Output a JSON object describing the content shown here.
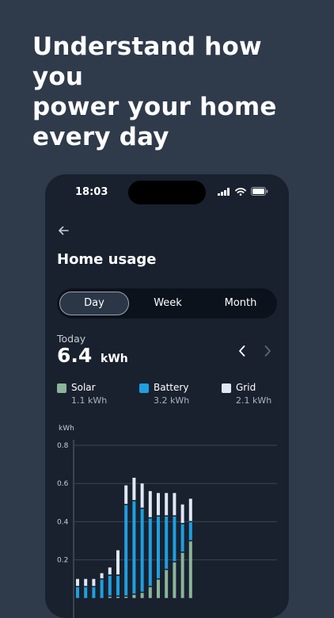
{
  "headline": [
    "Understand how you",
    "power your home",
    "every day"
  ],
  "status_bar": {
    "time": "18:03"
  },
  "screen": {
    "title": "Home usage",
    "tabs": [
      {
        "label": "Day",
        "active": true
      },
      {
        "label": "Week",
        "active": false
      },
      {
        "label": "Month",
        "active": false
      }
    ],
    "summary": {
      "period": "Today",
      "value": "6.4",
      "unit": "kWh"
    },
    "legend": [
      {
        "name": "Solar",
        "value": "1.1 kWh",
        "color": "#8ab59a"
      },
      {
        "name": "Battery",
        "value": "3.2 kWh",
        "color": "#1f9fe0"
      },
      {
        "name": "Grid",
        "value": "2.1 kWh",
        "color": "#dfe8f6"
      }
    ]
  },
  "chart_data": {
    "type": "bar",
    "stacked": true,
    "ylabel": "kWh",
    "ylim": [
      0,
      0.8
    ],
    "yticks": [
      "0.8",
      "0.6",
      "0.4",
      "0.2"
    ],
    "grid": true,
    "colors": {
      "Solar": "#8ab59a",
      "Battery": "#1f9fe0",
      "Grid": "#dfe8f6"
    },
    "series": [
      {
        "name": "Solar",
        "values": [
          0,
          0,
          0,
          0,
          0.01,
          0.01,
          0.01,
          0.02,
          0.03,
          0.06,
          0.1,
          0.15,
          0.19,
          0.24,
          0.3
        ]
      },
      {
        "name": "Battery",
        "values": [
          0.06,
          0.06,
          0.06,
          0.1,
          0.11,
          0.11,
          0.48,
          0.49,
          0.44,
          0.36,
          0.33,
          0.28,
          0.24,
          0.15,
          0.1
        ]
      },
      {
        "name": "Grid",
        "values": [
          0.04,
          0.04,
          0.04,
          0.03,
          0.04,
          0.13,
          0.1,
          0.12,
          0.13,
          0.14,
          0.12,
          0.12,
          0.12,
          0.1,
          0.12
        ]
      }
    ]
  }
}
